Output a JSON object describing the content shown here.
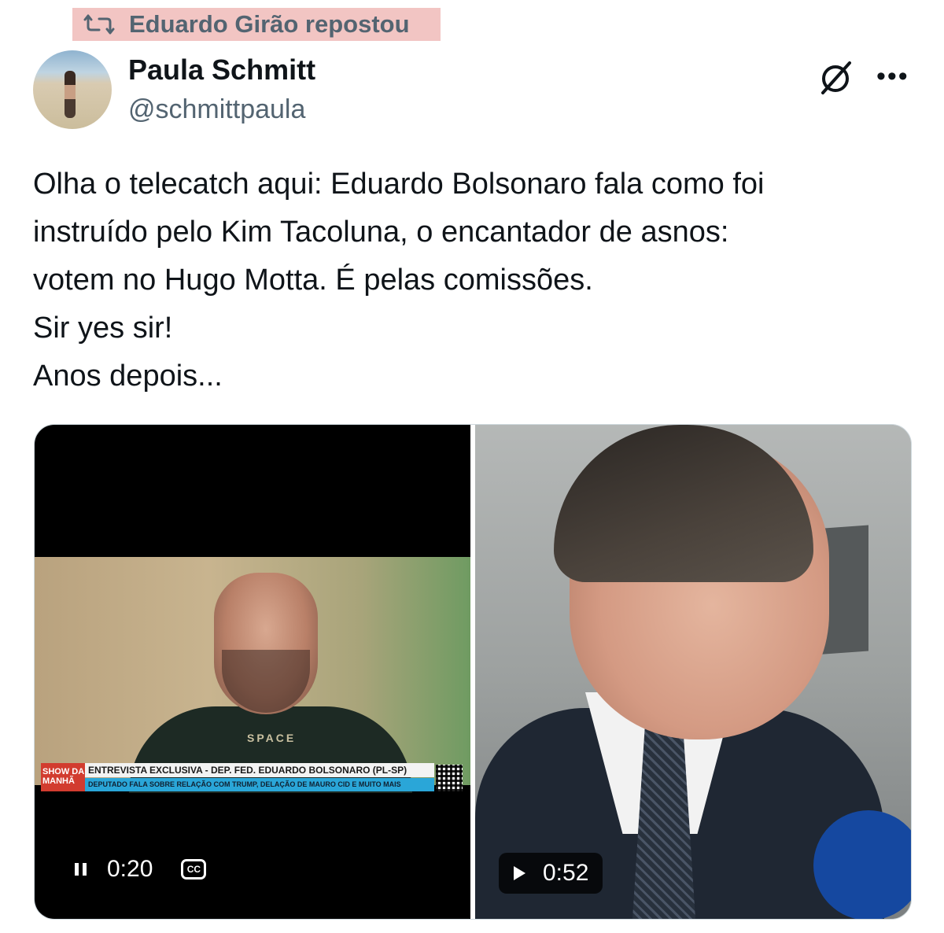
{
  "repost": {
    "label": "Eduardo Girão repostou",
    "highlight_color": "#f2c5c3",
    "icon": "repost-icon"
  },
  "author": {
    "name": "Paula Schmitt",
    "handle": "@schmittpaula"
  },
  "header_icons": {
    "grok": "grok-icon",
    "more": "more-icon",
    "more_glyph": "•••"
  },
  "tweet": {
    "lines": [
      "Olha o telecatch aqui: Eduardo Bolsonaro fala como foi",
      "instruído pelo Kim Tacoluna, o encantador de asnos:",
      "votem no Hugo Motta. É pelas comissões.",
      "Sir yes sir!",
      "Anos depois..."
    ]
  },
  "media": {
    "left_video": {
      "time": "0:20",
      "state": "playing",
      "shirt_text": "SPACE",
      "lower_third": {
        "logo": "SHOW DA MANHÃ",
        "line1": "ENTREVISTA EXCLUSIVA - DEP. FED. EDUARDO BOLSONARO (PL-SP)",
        "line2": "DEPUTADO FALA SOBRE RELAÇÃO COM TRUMP, DELAÇÃO DE MAURO CID E MUITO MAIS"
      },
      "cc_label": "CC"
    },
    "right_video": {
      "time": "0:52",
      "state": "paused"
    }
  }
}
